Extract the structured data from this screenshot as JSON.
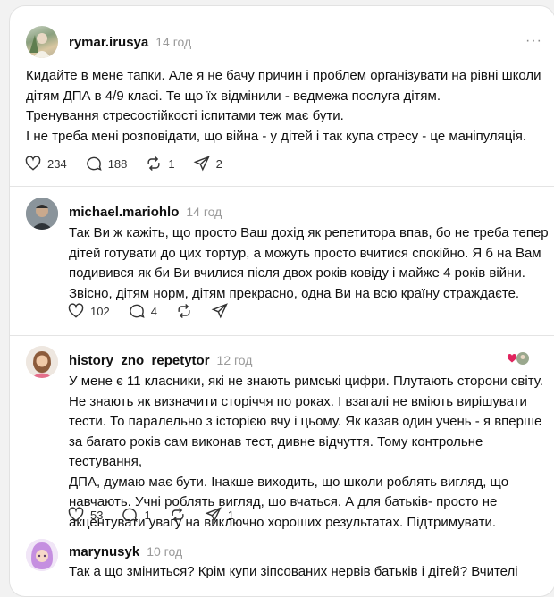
{
  "posts": [
    {
      "username": "rymar.irusya",
      "time": "14 год",
      "text": "Кидайте в мене тапки. Але я не бачу причин і проблем організувати на рівні школи\nдітям ДПА в 4/9 класі. Те що їх відмінили - ведмежа послуга дітям.\nТренування стресостійкості іспитами теж має бути.\nІ не треба мені розповідати, що війна - у дітей і так купа стресу - це маніпуляція.",
      "likes": "234",
      "replies": "188",
      "reposts": "1",
      "shares": "2"
    },
    {
      "username": "michael.mariohlo",
      "time": "14 год",
      "text": "Так Ви ж кажіть, що просто Ваш дохід як репетитора впав, бо не треба тепер\nдітей готувати до цих тортур, а можуть просто вчитися спокійно. Я б на Вам\nподивився як би Ви вчилися після двох років ковіду і майже 4 років війни.\nЗвісно, дітям норм, дітям прекрасно, одна Ви на всю країну страждаєте.",
      "likes": "102",
      "replies": "4",
      "reposts": "",
      "shares": ""
    },
    {
      "username": "history_zno_repetytor",
      "time": "12 год",
      "text": "У мене є 11 класники, які не знають римські цифри. Плутають сторони світу.\nНе знають як визначити сторіччя по роках. І взагалі не вміють вирішувати\nтести. То паралельно з історією вчу і цьому. Як казав один учень - я вперше\nза багато років сам виконав тест, дивне відчуття. Тому контрольне тестування,\nДПА, думаю має бути. Інакше виходить, що школи роблять вигляд, що\nнавчають. Учні роблять вигляд, шо вчаться. А для батьків- просто не\nакцентувати увагу на виключно хороших результатах. Підтримувати.",
      "likes": "53",
      "replies": "1",
      "reposts": "",
      "shares": "1"
    },
    {
      "username": "marynusyk",
      "time": "10 год",
      "text": "Так а що зміниться? Крім купи зіпсованих нервів батьків і дітей? Вчителі"
    }
  ],
  "more_label": "···",
  "icons": {
    "like": "heart-icon",
    "reply": "comment-icon",
    "repost": "repost-icon",
    "share": "share-icon"
  }
}
